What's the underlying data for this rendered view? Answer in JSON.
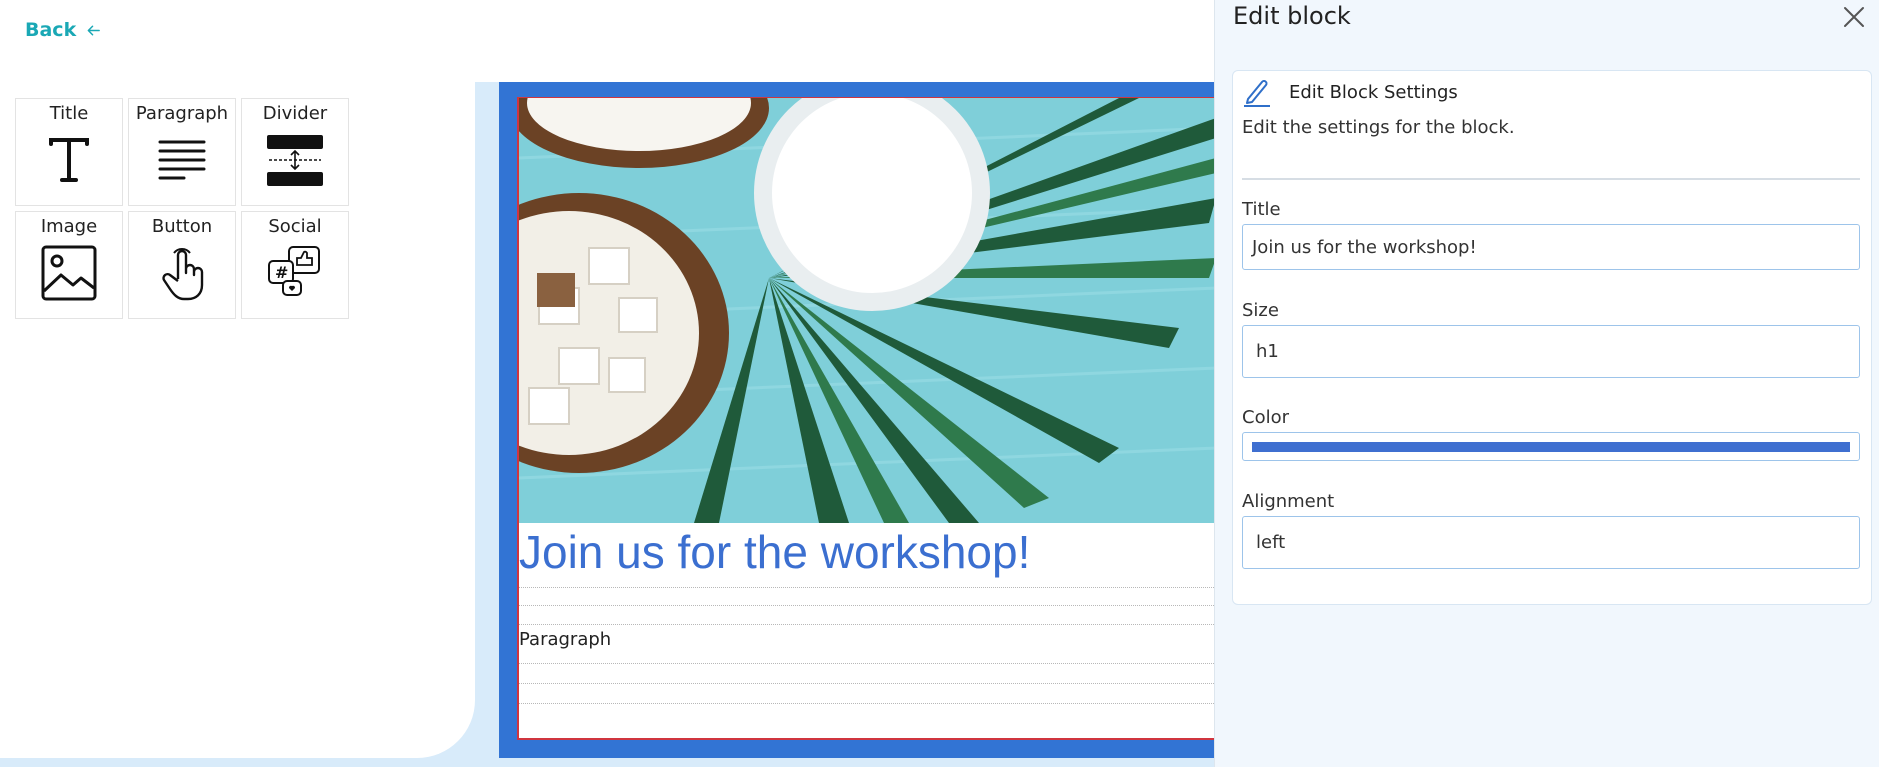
{
  "nav": {
    "back_label": "Back"
  },
  "blocks": [
    {
      "label": "Title",
      "icon": "title-text-icon"
    },
    {
      "label": "Paragraph",
      "icon": "paragraph-icon"
    },
    {
      "label": "Divider",
      "icon": "divider-icon"
    },
    {
      "label": "Image",
      "icon": "image-icon"
    },
    {
      "label": "Button",
      "icon": "pointer-hand-icon"
    },
    {
      "label": "Social",
      "icon": "social-icon"
    }
  ],
  "canvas": {
    "title": "Join us for the workshop!",
    "paragraph": "Paragraph",
    "frame_color": "#3274d4",
    "title_color": "#3b6fd0"
  },
  "edit_panel": {
    "title": "Edit block",
    "card_heading": "Edit Block Settings",
    "card_description": "Edit the settings for the block.",
    "title_label": "Title",
    "title_value": "Join us for the workshop!",
    "size_label": "Size",
    "size_value": "h1",
    "color_label": "Color",
    "color_value": "#3f6fd0",
    "alignment_label": "Alignment",
    "alignment_value": "left"
  }
}
